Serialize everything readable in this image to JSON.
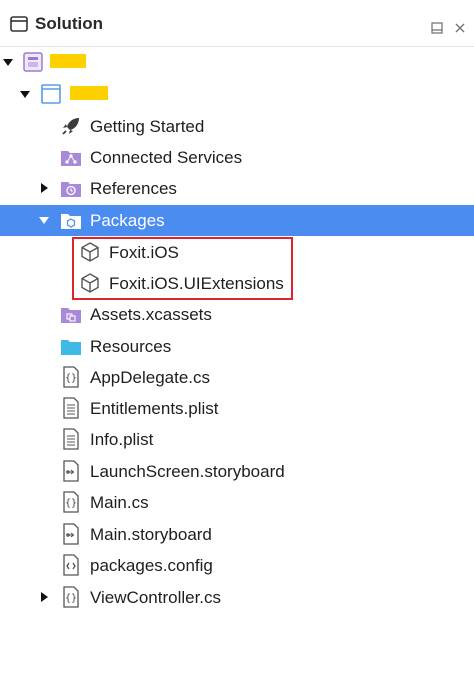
{
  "panel": {
    "title": "Solution",
    "accent": "#4a8cf0",
    "highlight_color": "#e0242b"
  },
  "tree": {
    "getting_started": "Getting Started",
    "connected_services": "Connected Services",
    "references": "References",
    "packages": "Packages",
    "pkg_foxit_ios": "Foxit.iOS",
    "pkg_foxit_uiext": "Foxit.iOS.UIExtensions",
    "assets": "Assets.xcassets",
    "resources": "Resources",
    "appdelegate": "AppDelegate.cs",
    "entitlements": "Entitlements.plist",
    "infoplist": "Info.plist",
    "launchscreen": "LaunchScreen.storyboard",
    "maincs": "Main.cs",
    "mainstoryboard": "Main.storyboard",
    "packagesconfig": "packages.config",
    "viewcontroller": "ViewController.cs"
  }
}
